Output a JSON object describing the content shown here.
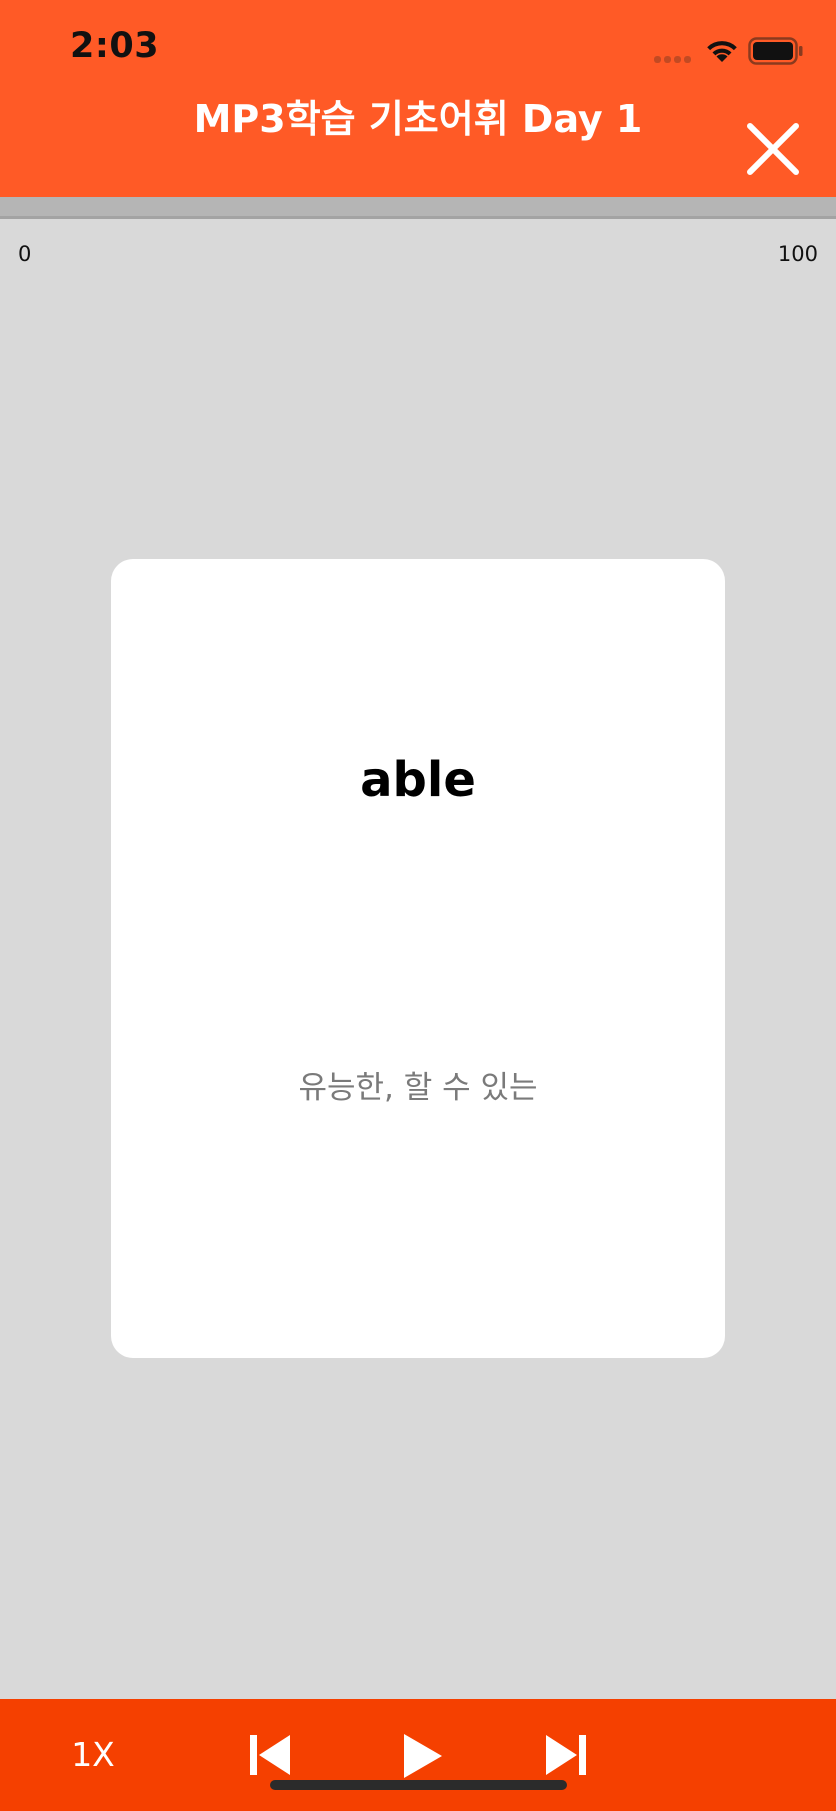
{
  "status_bar": {
    "time": "2:03"
  },
  "header": {
    "title": "MP3학습 기초어휘 Day 1"
  },
  "progress": {
    "min_label": "0",
    "max_label": "100",
    "value": 0
  },
  "card": {
    "word": "able",
    "meaning": "유능한, 할 수 있는"
  },
  "player": {
    "speed_label": "1X"
  },
  "colors": {
    "accent": "#ff5a26",
    "controls_bar": "#f54000",
    "background": "#d9d9d9"
  },
  "icons": {
    "close": "close-icon",
    "previous": "skip-previous-icon",
    "play": "play-icon",
    "next": "skip-next-icon"
  }
}
